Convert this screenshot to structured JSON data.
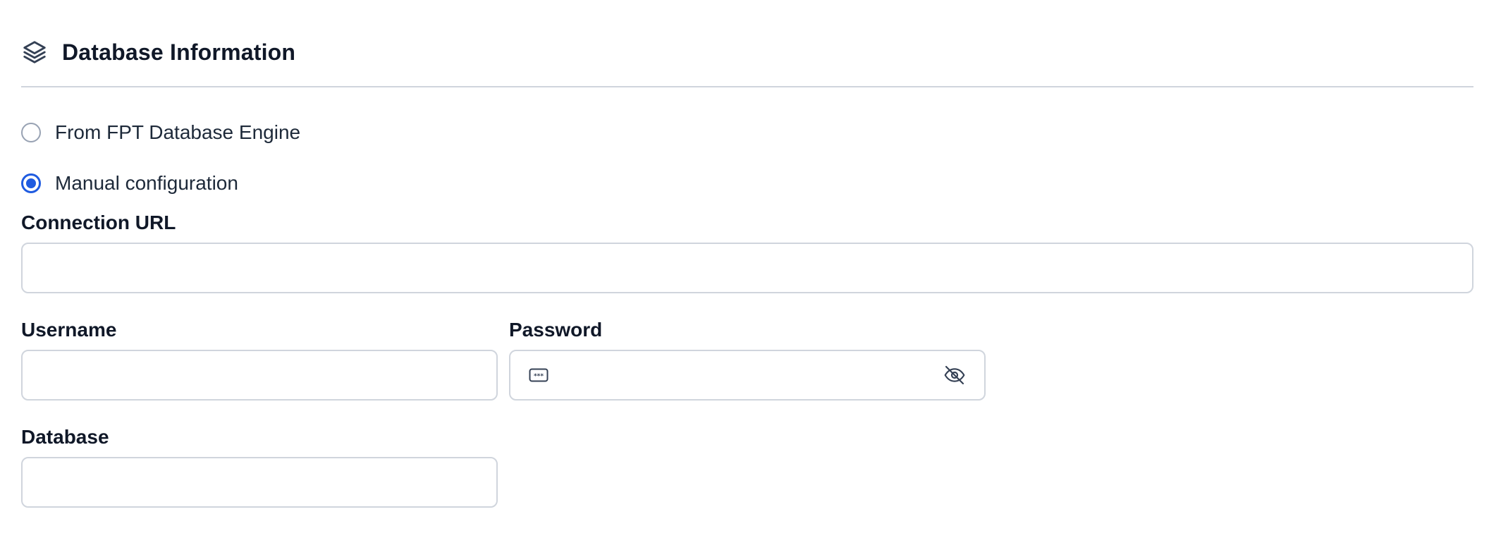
{
  "section": {
    "title": "Database Information",
    "icon": "layers-icon"
  },
  "source_options": [
    {
      "label": "From FPT Database Engine",
      "checked": false
    },
    {
      "label": "Manual configuration",
      "checked": true
    }
  ],
  "fields": {
    "connection_url": {
      "label": "Connection URL",
      "value": ""
    },
    "username": {
      "label": "Username",
      "value": ""
    },
    "password": {
      "label": "Password",
      "value": "",
      "prefix_icon": "password-dots-icon",
      "toggle_icon": "eye-off-icon"
    },
    "database": {
      "label": "Database",
      "value": ""
    }
  },
  "colors": {
    "accent": "#1f5be0",
    "border": "#d0d5dd",
    "text": "#101828"
  }
}
